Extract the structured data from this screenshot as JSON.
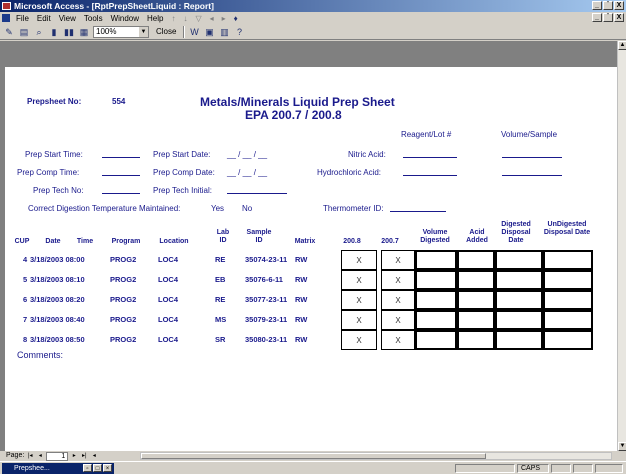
{
  "window": {
    "title": "Microsoft Access - [RptPrepSheetLiquid : Report]",
    "controls": [
      "_",
      "̄",
      "X"
    ],
    "inner_controls": [
      "_",
      "̄",
      "X"
    ]
  },
  "menu": {
    "items": [
      "File",
      "Edit",
      "View",
      "Tools",
      "Window",
      "Help"
    ]
  },
  "toolbar": {
    "zoom": "100%",
    "close_label": "Close",
    "icons": [
      "design-view-icon",
      "print-icon",
      "zoom-icon",
      "one-page-icon",
      "two-pages-icon",
      "multiple-pages-icon"
    ]
  },
  "report": {
    "prepsheet_label": "Prepsheet No:",
    "prepsheet_no": "554",
    "title": "Metals/Minerals Liquid Prep Sheet",
    "subtitle": "EPA 200.7 / 200.8",
    "reagent_label": "Reagent/Lot #",
    "volume_sample_label": "Volume/Sample",
    "prep_start_time": "Prep Start Time:",
    "prep_start_date": "Prep Start Date:",
    "prep_comp_time": "Prep Comp Time:",
    "prep_comp_date": "Prep Comp Date:",
    "prep_tech_no": "Prep Tech No:",
    "prep_tech_initial": "Prep Tech Initial:",
    "date_blank": "__ / __ / __",
    "nitric_acid": "Nitric Acid:",
    "hydrochloric_acid": "Hydrochloric Acid:",
    "correct_digestion": "Correct Digestion Temperature Maintained:",
    "yes": "Yes",
    "no": "No",
    "thermometer_id": "Thermometer ID:",
    "comments": "Comments:"
  },
  "table": {
    "headers": {
      "cup": "CUP",
      "date": "Date",
      "time": "Time",
      "program": "Program",
      "location": "Location",
      "lab_id": "Lab ID",
      "sample_id": "Sample ID",
      "matrix": "Matrix",
      "m2008": "200.8",
      "m2007": "200.7",
      "volume_digested": "Volume Digested",
      "acid_added": "Acid Added",
      "digested_disposal": "Digested Disposal Date",
      "undigested_disposal": "UnDigested Disposal Date"
    },
    "rows": [
      {
        "cup": "4",
        "datetime": "3/18/2003 08:00",
        "program": "PROG2",
        "location": "LOC4",
        "lab_id": "RE",
        "sample_id": "35074-23-11",
        "matrix": "RW",
        "m2008": "X",
        "m2007": "X"
      },
      {
        "cup": "5",
        "datetime": "3/18/2003 08:10",
        "program": "PROG2",
        "location": "LOC4",
        "lab_id": "EB",
        "sample_id": "35076-6-11",
        "matrix": "RW",
        "m2008": "X",
        "m2007": "X"
      },
      {
        "cup": "6",
        "datetime": "3/18/2003 08:20",
        "program": "PROG2",
        "location": "LOC4",
        "lab_id": "RE",
        "sample_id": "35077-23-11",
        "matrix": "RW",
        "m2008": "X",
        "m2007": "X"
      },
      {
        "cup": "7",
        "datetime": "3/18/2003 08:40",
        "program": "PROG2",
        "location": "LOC4",
        "lab_id": "MS",
        "sample_id": "35079-23-11",
        "matrix": "RW",
        "m2008": "X",
        "m2007": "X"
      },
      {
        "cup": "8",
        "datetime": "3/18/2003 08:50",
        "program": "PROG2",
        "location": "LOC4",
        "lab_id": "SR",
        "sample_id": "35080-23-11",
        "matrix": "RW",
        "m2008": "X",
        "m2007": "X"
      }
    ]
  },
  "statusbar": {
    "page_label": "Page:",
    "page_no": "1"
  },
  "taskbar": {
    "task_label": "Prepshee...",
    "caps": "CAPS"
  }
}
